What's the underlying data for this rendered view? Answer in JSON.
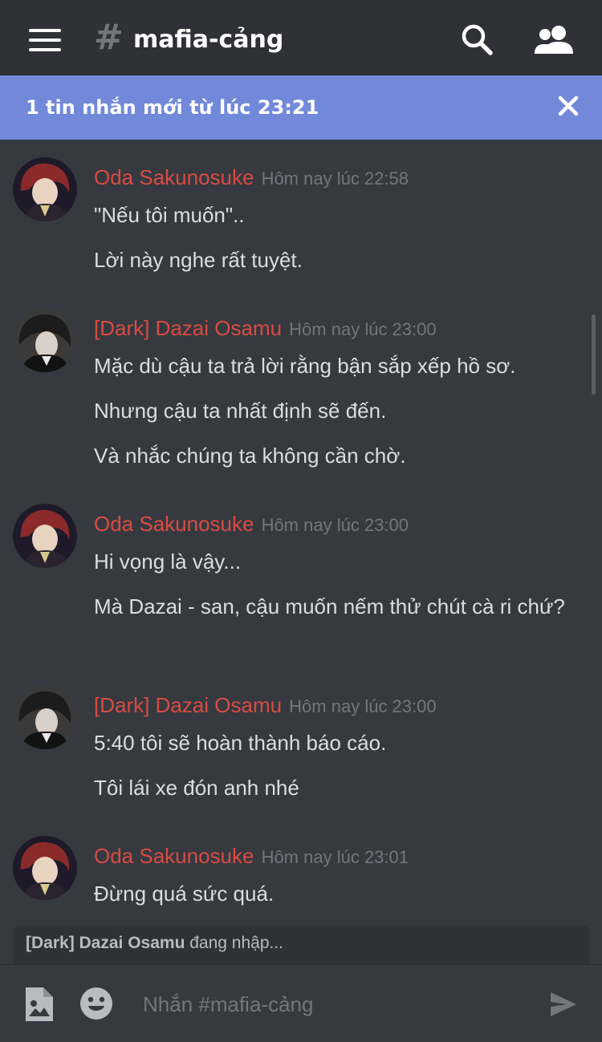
{
  "header": {
    "hash_symbol": "#",
    "channel": "mafia-cảng"
  },
  "banner": {
    "text": "1 tin nhắn mới từ lúc 23:21"
  },
  "messages": [
    {
      "author": "Oda Sakunosuke",
      "timestamp": "Hôm nay lúc 22:58",
      "lines": [
        "\"Nếu tôi muốn\"..",
        "Lời này nghe rất tuyệt."
      ]
    },
    {
      "author": "[Dark] Dazai Osamu",
      "timestamp": "Hôm nay lúc 23:00",
      "lines": [
        "Mặc dù cậu ta trả lời rằng bận sắp xếp hồ sơ.",
        "Nhưng cậu ta nhất định sẽ đến.",
        "Và nhắc chúng ta không cần chờ."
      ]
    },
    {
      "author": "Oda Sakunosuke",
      "timestamp": "Hôm nay lúc 23:00",
      "lines": [
        "Hi vọng là vậy...",
        "Mà Dazai - san, cậu muốn nếm thử chút cà ri chứ?"
      ]
    },
    {
      "author": "[Dark] Dazai Osamu",
      "timestamp": "Hôm nay lúc 23:00",
      "lines": [
        "5:40 tôi sẽ hoàn thành báo cáo.",
        "Tôi lái xe đón anh nhé"
      ]
    },
    {
      "author": "Oda Sakunosuke",
      "timestamp": "Hôm nay lúc 23:01",
      "lines": [
        "Đừng quá sức quá."
      ]
    }
  ],
  "typing": {
    "name": "[Dark] Dazai Osamu",
    "suffix": " đang nhập..."
  },
  "composer": {
    "placeholder": "Nhắn #mafia-cảng"
  },
  "icons": {
    "menu": "hamburger-menu-icon",
    "search": "search-icon",
    "members": "members-icon",
    "close": "close-icon",
    "image": "image-upload-icon",
    "emoji": "emoji-icon",
    "send": "send-icon"
  },
  "colors": {
    "accent_banner": "#7289da",
    "author_name": "#d84b43",
    "background": "#36393f",
    "header_bg": "#2f3136"
  }
}
